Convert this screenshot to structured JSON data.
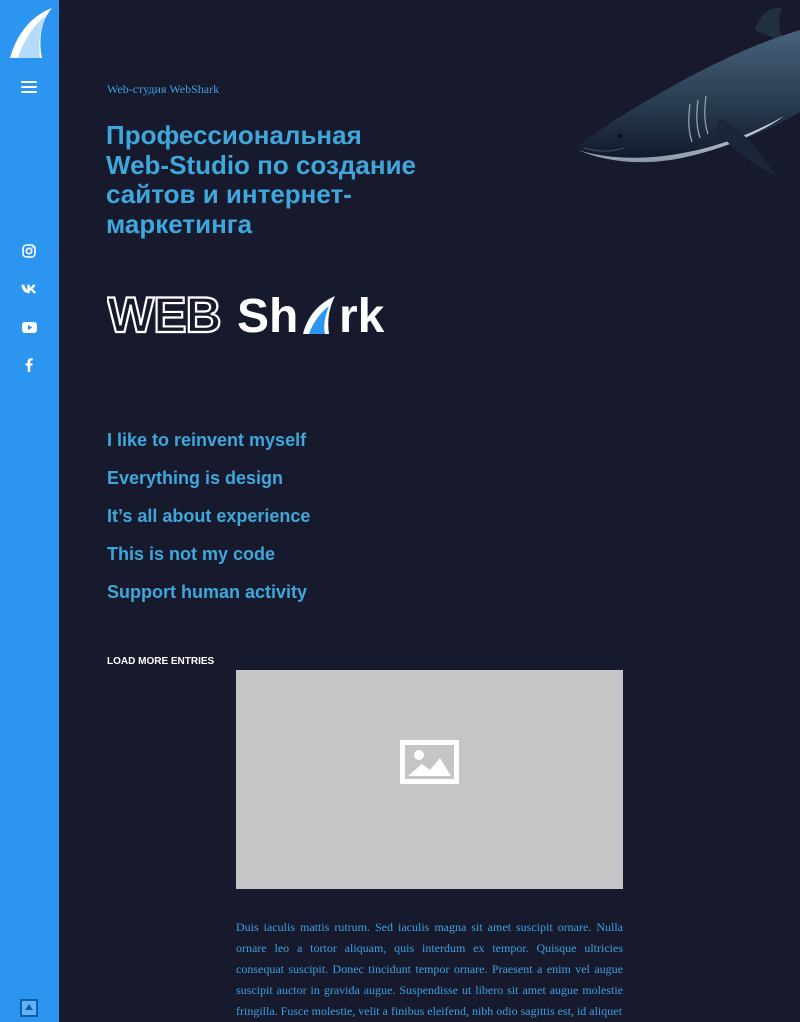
{
  "sidebar": {
    "logo_icon": "shark-fin-icon",
    "menu_icon": "hamburger-menu-icon",
    "social": [
      {
        "name": "instagram-icon"
      },
      {
        "name": "vk-icon"
      },
      {
        "name": "youtube-icon"
      },
      {
        "name": "facebook-icon"
      }
    ],
    "scroll_top_icon": "scroll-to-top-icon",
    "color": "#2b95f0"
  },
  "hero": {
    "eyebrow": "Web-студия WebShark",
    "title": "Профессиональная Web-Studio по создание сайтов и интернет-маркетинга",
    "brand_logo": "WEBShark"
  },
  "taglines": [
    "I like to reinvent myself",
    "Everything is design",
    "It’s all about experience",
    "This is not my code",
    "Support human activity"
  ],
  "load_more_label": "LOAD MORE ENTRIES",
  "article": {
    "image_icon": "image-placeholder-icon",
    "text": "Duis iaculis mattis rutrum. Sed iaculis magna sit amet suscipit ornare. Nulla ornare leo a tortor aliquam, quis interdum ex tempor. Quisque ultricies consequat suscipit. Donec tincidunt tempor ornare. Praesent a enim vel augue suscipit auctor in gravida augue. Suspendisse ut libero sit amet augue molestie fringilla. Fusce molestie, velit a finibus eleifend, nibh odio sagittis est, id aliquet"
  },
  "colors": {
    "background": "#161a2c",
    "accent": "#3fa7dc",
    "sidebar": "#2b95f0"
  }
}
